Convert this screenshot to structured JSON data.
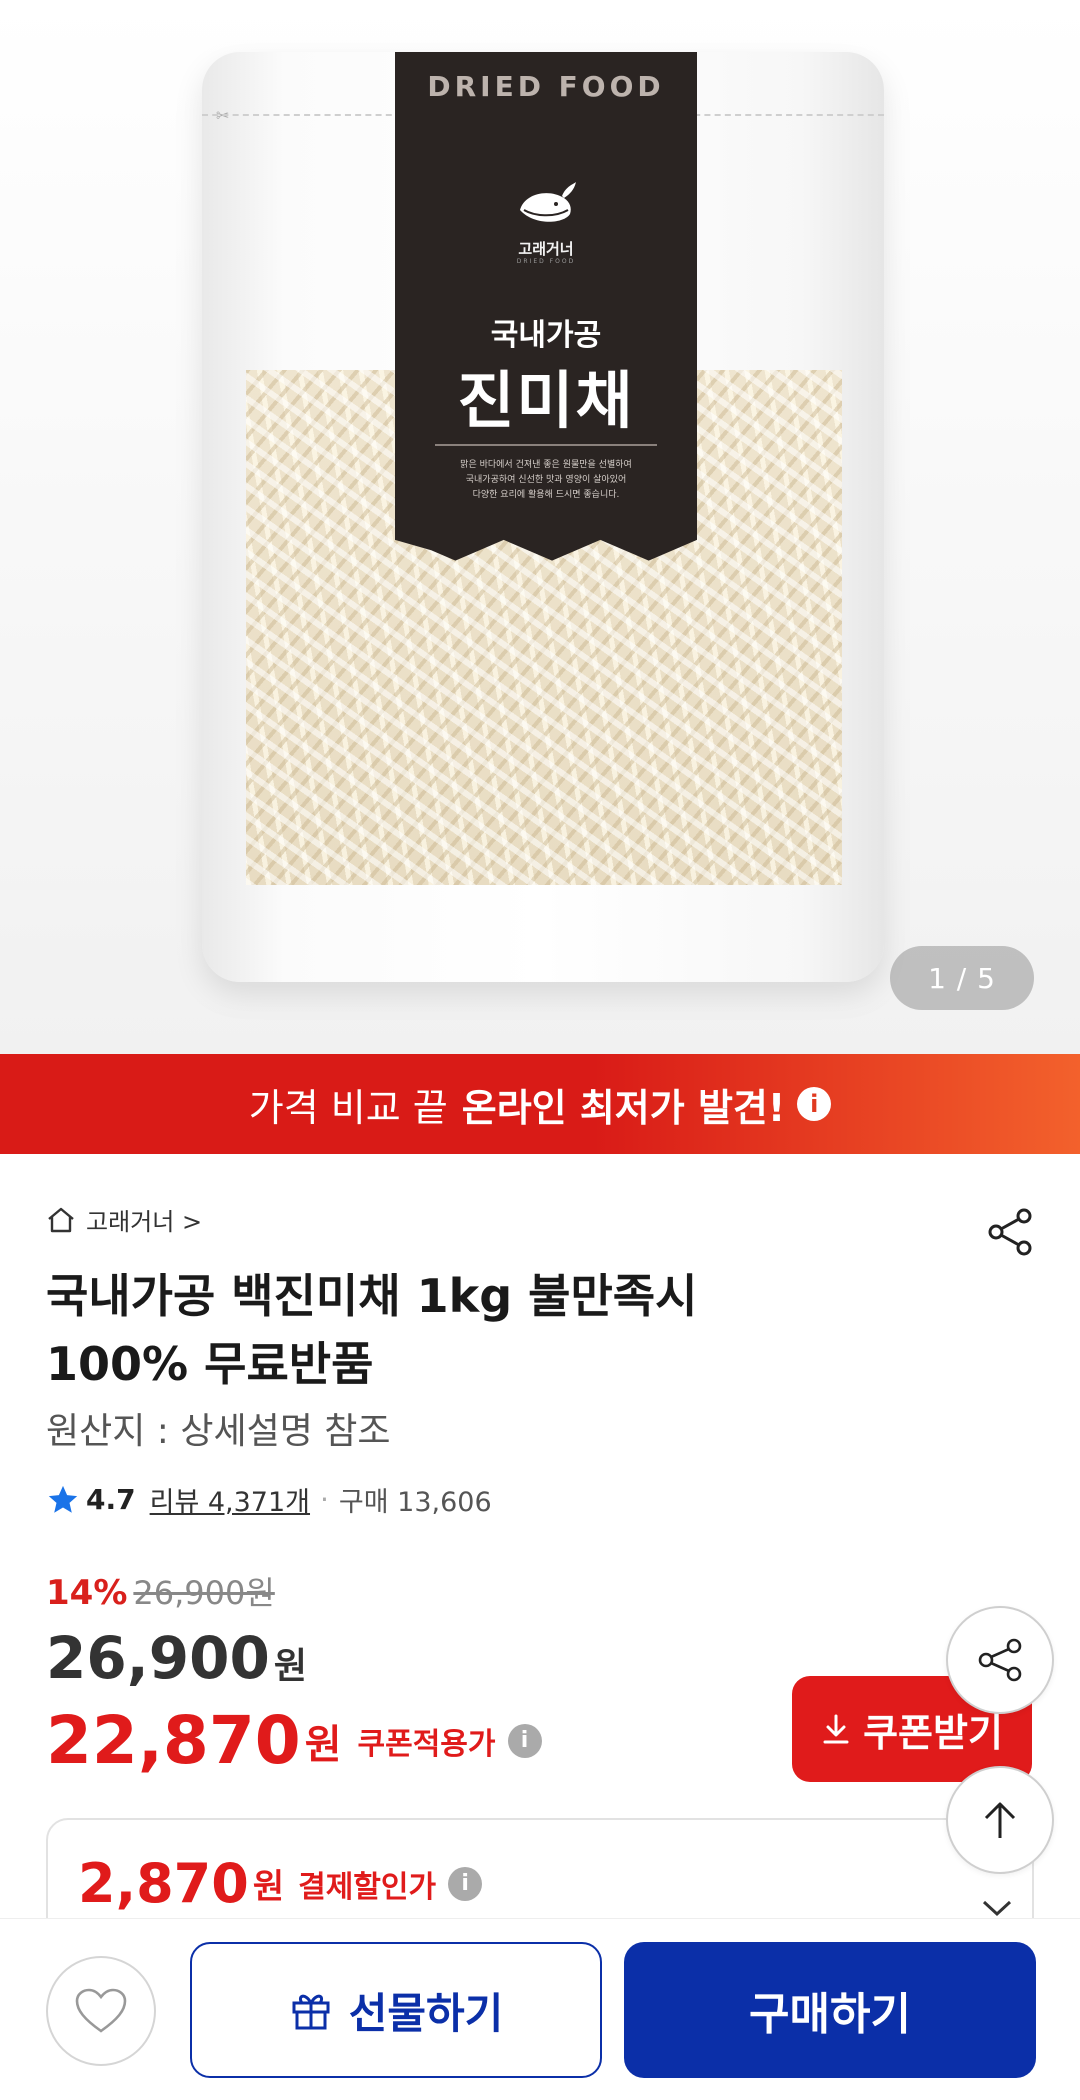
{
  "hero": {
    "package": {
      "top_text": "DRIED FOOD",
      "brand": "고래거너",
      "brand_sub": "DRIED FOOD",
      "line1": "국내가공",
      "line2": "진미채",
      "desc_1": "맑은 바다에서 건져낸 좋은 원물만을 선별하여",
      "desc_2": "국내가공하여 신선한 맛과 영양이 살아있어",
      "desc_3": "다양한 요리에 활용해 드시면 좋습니다."
    },
    "image_counter": "1 / 5"
  },
  "promo": {
    "light_text": "가격 비교 끝",
    "bold_text": "온라인 최저가 발견!",
    "info_icon": "i"
  },
  "product": {
    "breadcrumb": "고래거너 >",
    "title": "국내가공 백진미채 1kg 불만족시 100% 무료반품",
    "origin": "원산지 : 상세설명 참조",
    "rating": "4.7",
    "reviews": "리뷰 4,371개",
    "separator": "·",
    "purchases": "구매 13,606",
    "discount_pct": "14%",
    "original_price": "26,900원",
    "price": "26,900",
    "price_unit": "원",
    "coupon_price": "22,870",
    "coupon_unit": "원",
    "coupon_label": "쿠폰적용가",
    "coupon_button": "쿠폰받기",
    "pay_discount": "2,870",
    "pay_unit": "원",
    "pay_label": "결제할인가"
  },
  "bottom_bar": {
    "gift_label": "선물하기",
    "buy_label": "구매하기"
  },
  "colors": {
    "brand_red": "#e01b1b",
    "brand_blue": "#0b2fa8",
    "star_blue": "#1a73e8"
  },
  "icons": [
    "home-icon",
    "share-icon",
    "star-icon",
    "info-icon",
    "download-icon",
    "arrow-up-icon",
    "chevron-down-icon",
    "heart-icon",
    "gift-icon"
  ]
}
